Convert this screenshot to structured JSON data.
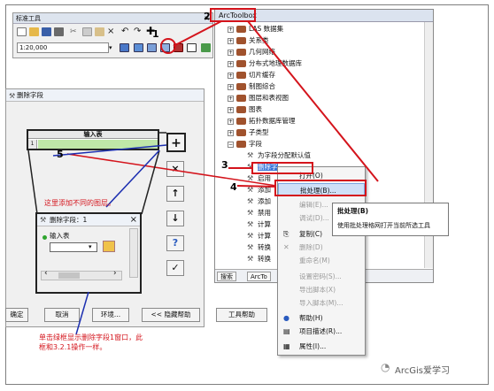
{
  "toolbar": {
    "title": "标准工具",
    "scale_value": "1:20,000"
  },
  "arctoolbox": {
    "title": "ArcToolbox",
    "items": [
      {
        "label": "LAS 数据集"
      },
      {
        "label": "关系类"
      },
      {
        "label": "几何网络"
      },
      {
        "label": "分布式地理数据库"
      },
      {
        "label": "切片缓存"
      },
      {
        "label": "制图综合"
      },
      {
        "label": "图层和表视图"
      },
      {
        "label": "图表"
      },
      {
        "label": "拓扑数据库管理"
      },
      {
        "label": "子类型"
      },
      {
        "label": "字段"
      }
    ],
    "field_tools": [
      {
        "label": "为字段分配默认值"
      },
      {
        "label": "删除字"
      },
      {
        "label": "启用"
      },
      {
        "label": "添加"
      },
      {
        "label": "添加"
      },
      {
        "label": "禁用"
      },
      {
        "label": "计算"
      },
      {
        "label": "计算"
      },
      {
        "label": "转换"
      },
      {
        "label": "转换"
      }
    ],
    "tabs": [
      "搜索",
      "ArcTo"
    ]
  },
  "context_menu": {
    "items": [
      {
        "label": "打开(O)",
        "enabled": true
      },
      {
        "label": "批处理(B)...",
        "enabled": true
      },
      {
        "label": "编辑(E)...",
        "enabled": false
      },
      {
        "label": "调试(D)...",
        "enabled": false
      },
      {
        "label": "复制(C)",
        "enabled": true
      },
      {
        "label": "删除(D)",
        "enabled": false
      },
      {
        "label": "重命名(M)",
        "enabled": false
      },
      {
        "label": "设置密码(S)...",
        "enabled": false
      },
      {
        "label": "导出脚本(X)",
        "enabled": false
      },
      {
        "label": "导入脚本(M)...",
        "enabled": false
      },
      {
        "label": "帮助(H)",
        "enabled": true
      },
      {
        "label": "项目描述(R)...",
        "enabled": true
      },
      {
        "label": "属性(I)...",
        "enabled": true
      }
    ]
  },
  "tooltip": {
    "title": "批处理(B)",
    "text": "使用批处理格网打开当前所选工具"
  },
  "delete_field_dialog": {
    "title": "删除字段",
    "grid_header": "输入表",
    "grid_row_num": "1"
  },
  "sub_dialog": {
    "title": "删除字段：1",
    "field_label": "输入表"
  },
  "bottom_buttons": [
    "确定",
    "取消",
    "环境...",
    "<< 隐藏帮助",
    "工具帮助"
  ],
  "annotations": {
    "add_layers_note": "这里添加不同的图层。",
    "bottom_note": "单击绿框显示删除字段1窗口，此框和3.2.1操作一样。",
    "numbers": [
      "1",
      "2",
      "3",
      "4",
      "5"
    ]
  },
  "watermark": "ArcGis爱学习",
  "colors": {
    "annotation_red": "#d4141c",
    "annotation_blue": "#1c2fb0",
    "selection_blue": "#3874d8",
    "grid_green": "#bfe7a8"
  }
}
